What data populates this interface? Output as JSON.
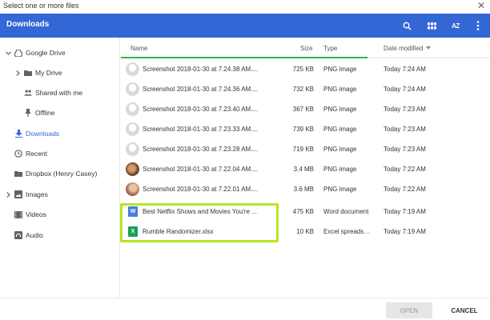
{
  "window": {
    "title": "Select one or more files"
  },
  "header": {
    "location": "Downloads",
    "sort_label": "AZ"
  },
  "sidebar": {
    "items": [
      {
        "label": "Google Drive"
      },
      {
        "label": "My Drive"
      },
      {
        "label": "Shared with me"
      },
      {
        "label": "Offline"
      },
      {
        "label": "Downloads"
      },
      {
        "label": "Recent"
      },
      {
        "label": "Dropbox (Henry Casey)"
      },
      {
        "label": "Images"
      },
      {
        "label": "Videos"
      },
      {
        "label": "Audio"
      }
    ]
  },
  "columns": {
    "name": "Name",
    "size": "Size",
    "type": "Type",
    "date": "Date modified"
  },
  "files": [
    {
      "name": "Screenshot 2018-01-30 at 7.24.38 AM....",
      "size": "725 KB",
      "type": "PNG image",
      "date": "Today 7:24 AM"
    },
    {
      "name": "Screenshot 2018-01-30 at 7.24.36 AM....",
      "size": "732 KB",
      "type": "PNG image",
      "date": "Today 7:24 AM"
    },
    {
      "name": "Screenshot 2018-01-30 at 7.23.40 AM....",
      "size": "367 KB",
      "type": "PNG image",
      "date": "Today 7:23 AM"
    },
    {
      "name": "Screenshot 2018-01-30 at 7.23.33 AM....",
      "size": "739 KB",
      "type": "PNG image",
      "date": "Today 7:23 AM"
    },
    {
      "name": "Screenshot 2018-01-30 at 7.23.28 AM....",
      "size": "719 KB",
      "type": "PNG image",
      "date": "Today 7:23 AM"
    },
    {
      "name": "Screenshot 2018-01-30 at 7.22.04 AM....",
      "size": "3.4 MB",
      "type": "PNG image",
      "date": "Today 7:22 AM"
    },
    {
      "name": "Screenshot 2018-01-30 at 7.22.01 AM....",
      "size": "3.6 MB",
      "type": "PNG image",
      "date": "Today 7:22 AM"
    },
    {
      "name": "Best Netflix Shows and Movies You're ...",
      "size": "475 KB",
      "type": "Word document",
      "date": "Today 7:19 AM",
      "icon_letter": "W"
    },
    {
      "name": "Rumble Randomizer.xlsx",
      "size": "10 KB",
      "type": "Excel spreadsh...",
      "date": "Today 7:19 AM",
      "icon_letter": "X"
    }
  ],
  "footer": {
    "open_label": "OPEN",
    "cancel_label": "CANCEL"
  },
  "colors": {
    "header_blue": "#3367d6",
    "highlight_green": "#b5e61d",
    "word_blue": "#4a7bd8",
    "excel_green": "#1e9e57"
  }
}
